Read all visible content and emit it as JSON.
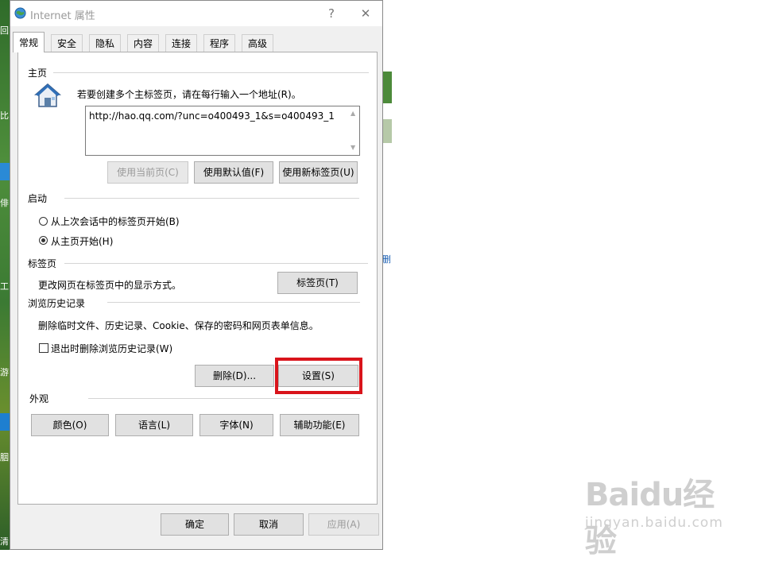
{
  "window": {
    "title": "Internet 属性",
    "help_glyph": "?",
    "close_glyph": "✕"
  },
  "tabs": [
    {
      "label": "常规",
      "active": true
    },
    {
      "label": "安全"
    },
    {
      "label": "隐私"
    },
    {
      "label": "内容"
    },
    {
      "label": "连接"
    },
    {
      "label": "程序"
    },
    {
      "label": "高级"
    }
  ],
  "homepage": {
    "section": "主页",
    "instruction": "若要创建多个主标签页，请在每行输入一个地址(R)。",
    "url": "http://hao.qq.com/?unc=o400493_1&s=o400493_1",
    "btn_current": "使用当前页(C)",
    "btn_default": "使用默认值(F)",
    "btn_newtab": "使用新标签页(U)"
  },
  "startup": {
    "section": "启动",
    "option_last_session": "从上次会话中的标签页开始(B)",
    "option_homepage": "从主页开始(H)",
    "selected": "option_homepage"
  },
  "tabs_section": {
    "section": "标签页",
    "description": "更改网页在标签页中的显示方式。",
    "btn_tabs": "标签页(T)"
  },
  "history": {
    "section": "浏览历史记录",
    "description": "删除临时文件、历史记录、Cookie、保存的密码和网页表单信息。",
    "checkbox_delete_on_exit": "退出时删除浏览历史记录(W)",
    "checked": false,
    "btn_delete": "删除(D)...",
    "btn_settings": "设置(S)"
  },
  "appearance": {
    "section": "外观",
    "btn_colors": "颜色(O)",
    "btn_languages": "语言(L)",
    "btn_fonts": "字体(N)",
    "btn_accessibility": "辅助功能(E)"
  },
  "footer": {
    "ok": "确定",
    "cancel": "取消",
    "apply": "应用(A)"
  },
  "desktop_left_chars": [
    "回",
    "比",
    "俳",
    "工",
    "游",
    "胭",
    "清"
  ],
  "right_fragment_char": "删",
  "watermark": {
    "brand": "Baidu经验",
    "url": "jingyan.baidu.com"
  },
  "colors": {
    "highlight": "#d9141b",
    "dialog_bg": "#f0f0f0"
  }
}
